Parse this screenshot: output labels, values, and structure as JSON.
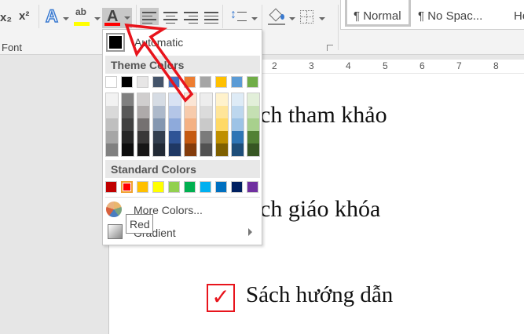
{
  "ribbon": {
    "subscript_label": "x₂",
    "superscript_label": "x²",
    "text_effects_label": "A",
    "highlight_label": "ab",
    "font_color_label": "A",
    "font_group_label": "Font",
    "highlight_color": "#ffff00",
    "font_color": "#ff0000",
    "styles": [
      "¶ Normal",
      "¶ No Spac...",
      "Headi"
    ]
  },
  "ruler": {
    "numbers": [
      "2",
      "3",
      "4",
      "5",
      "6",
      "7",
      "8"
    ]
  },
  "document": {
    "lines": [
      "ch tham khảo",
      "ch giáo khóa",
      "Sách hướng dẫn"
    ],
    "checkbox_symbol": "✓"
  },
  "color_menu": {
    "automatic_label": "Automatic",
    "theme_colors_label": "Theme Colors",
    "standard_colors_label": "Standard Colors",
    "more_colors_label": "More Colors...",
    "gradient_label": "Gradient",
    "tooltip": "Red",
    "theme_colors": [
      "#ffffff",
      "#000000",
      "#e7e6e6",
      "#44546a",
      "#4472c4",
      "#ed7d31",
      "#a5a5a5",
      "#ffc000",
      "#5b9bd5",
      "#70ad47"
    ],
    "theme_shades": [
      [
        "#f2f2f2",
        "#d9d9d9",
        "#bfbfbf",
        "#a6a6a6",
        "#808080"
      ],
      [
        "#808080",
        "#595959",
        "#404040",
        "#262626",
        "#0d0d0d"
      ],
      [
        "#d0cece",
        "#aeaaaa",
        "#757171",
        "#3a3838",
        "#171616"
      ],
      [
        "#d6dce4",
        "#adb9ca",
        "#8497b0",
        "#333f4f",
        "#222a35"
      ],
      [
        "#d9e2f3",
        "#b4c6e7",
        "#8eaadb",
        "#2f5496",
        "#1f3864"
      ],
      [
        "#fbe5d5",
        "#f7cbac",
        "#f4b183",
        "#c55a11",
        "#843c0b"
      ],
      [
        "#ededed",
        "#dbdbdb",
        "#c9c9c9",
        "#7b7b7b",
        "#525252"
      ],
      [
        "#fff2cc",
        "#ffe599",
        "#ffd966",
        "#bf8f00",
        "#7f6000"
      ],
      [
        "#deebf6",
        "#bdd7ee",
        "#9dc3e6",
        "#2e75b5",
        "#1e4e79"
      ],
      [
        "#e2efd9",
        "#c5e0b3",
        "#a8d08d",
        "#538135",
        "#375623"
      ]
    ],
    "standard_colors": [
      "#c00000",
      "#ff0000",
      "#ffc000",
      "#ffff00",
      "#92d050",
      "#00b050",
      "#00b0f0",
      "#0070c0",
      "#002060",
      "#7030a0"
    ],
    "selected_standard_index": 1
  }
}
